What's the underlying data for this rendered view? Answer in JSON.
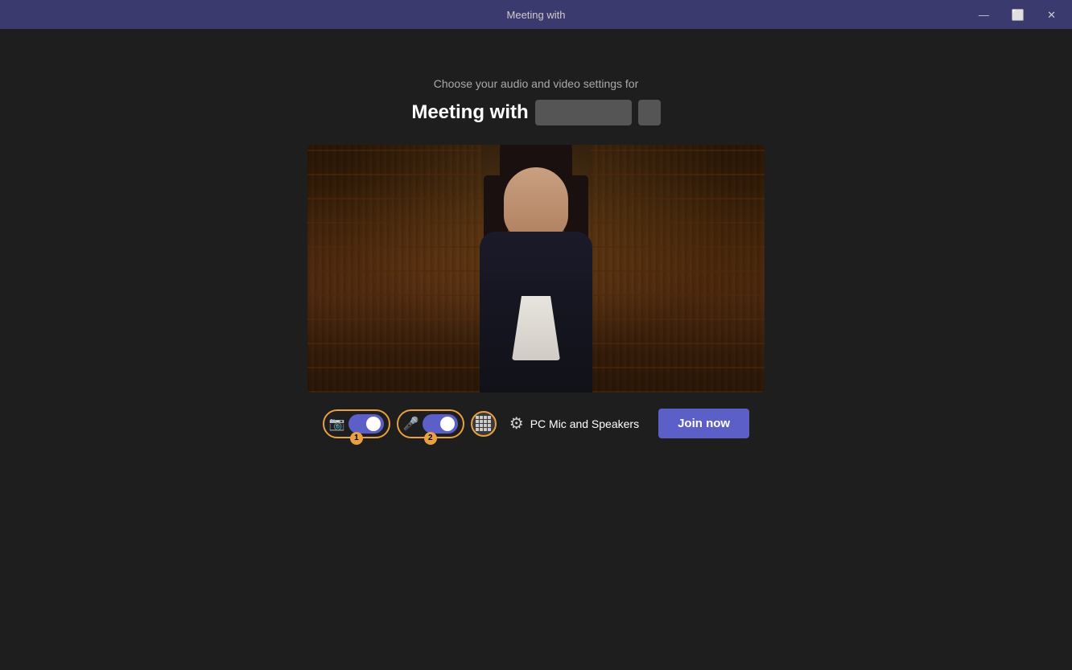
{
  "titlebar": {
    "title": "Meeting with",
    "minimize_label": "—",
    "restore_label": "⬜",
    "close_label": "✕"
  },
  "header": {
    "subtitle": "Choose your audio and video settings for",
    "meeting_title_prefix": "Meeting with",
    "meeting_title_redacted": ""
  },
  "controls": {
    "camera_badge": "1",
    "mic_badge": "2",
    "speaker_label": "PC Mic and Speakers",
    "join_button_label": "Join now"
  }
}
